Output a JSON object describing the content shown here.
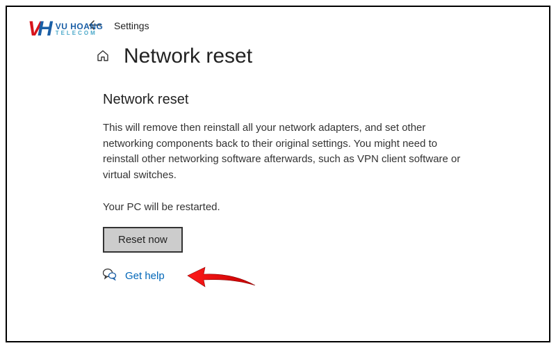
{
  "topbar": {
    "settings_label": "Settings"
  },
  "title": {
    "page_title": "Network reset"
  },
  "content": {
    "heading": "Network reset",
    "description": "This will remove then reinstall all your network adapters, and set other networking components back to their original settings. You might need to reinstall other networking software afterwards, such as VPN client software or virtual switches.",
    "restart_note": "Your PC will be restarted.",
    "reset_button_label": "Reset now",
    "help_link": "Get help"
  },
  "watermark": {
    "brand": "VU HOANG",
    "sub": "TELECOM"
  }
}
